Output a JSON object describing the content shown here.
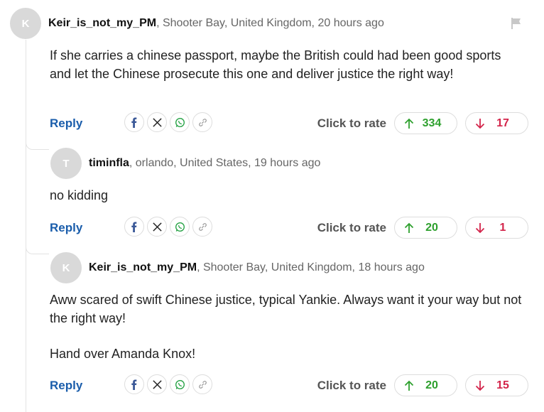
{
  "comments": [
    {
      "avatar_letter": "K",
      "username": "Keir_is_not_my_PM",
      "location_time": ", Shooter Bay, United Kingdom, 20 hours ago",
      "body": [
        "If she carries a chinese passport, maybe the British could had been good sports and let the Chinese prosecute this one and deliver justice the right way!"
      ],
      "reply_label": "Reply",
      "rate_label": "Click to rate",
      "upvotes": "334",
      "downvotes": "17"
    },
    {
      "avatar_letter": "T",
      "username": "timinfla",
      "location_time": ", orlando, United States, 19 hours ago",
      "body": [
        "no kidding"
      ],
      "reply_label": "Reply",
      "rate_label": "Click to rate",
      "upvotes": "20",
      "downvotes": "1"
    },
    {
      "avatar_letter": "K",
      "username": "Keir_is_not_my_PM",
      "location_time": ", Shooter Bay, United Kingdom, 18 hours ago",
      "body": [
        "Aww scared of swift Chinese justice, typical Yankie. Always want it your way but not the right way!",
        "Hand over Amanda Knox!"
      ],
      "reply_label": "Reply",
      "rate_label": "Click to rate",
      "upvotes": "20",
      "downvotes": "15"
    }
  ],
  "icons": {
    "share": [
      "facebook-icon",
      "x-icon",
      "whatsapp-icon",
      "link-icon"
    ],
    "report": "flag-icon",
    "up": "arrow-up-icon",
    "down": "arrow-down-icon"
  },
  "colors": {
    "upvote": "#2ea02e",
    "downvote": "#d3244a",
    "reply": "#1a5dab",
    "avatar": "#d9d9d9"
  }
}
